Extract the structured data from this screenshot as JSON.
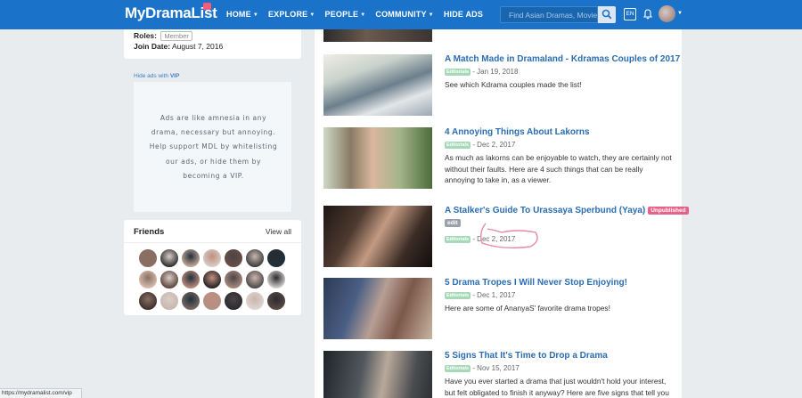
{
  "navbar": {
    "logo": "MyDramaList",
    "links": [
      {
        "label": "HOME",
        "dropdown": true
      },
      {
        "label": "EXPLORE",
        "dropdown": true
      },
      {
        "label": "PEOPLE",
        "dropdown": true
      },
      {
        "label": "COMMUNITY",
        "dropdown": true
      },
      {
        "label": "HIDE ADS",
        "dropdown": false
      }
    ],
    "search_placeholder": "Find Asian Dramas, Movies",
    "lang": "EN",
    "icons": [
      "search-icon",
      "bell-icon",
      "avatar"
    ]
  },
  "profile": {
    "roles_label": "Roles:",
    "role_badge": "Member",
    "join_label": "Join Date:",
    "join_value": "August 7, 2016"
  },
  "ads": {
    "hide_prefix": "Hide ads with",
    "hide_vip": "VIP",
    "lines": [
      "Ads are like amnesia in any",
      "drama, necessary but annoying.",
      "Help support MDL by whitelisting",
      "our ads, or hide them by",
      "becoming a VIP."
    ]
  },
  "friends": {
    "title": "Friends",
    "view_all": "View all",
    "count": 21
  },
  "articles": [
    {
      "title": "A Match Made in Dramaland - Kdramas Couples of 2017",
      "tag": "Editorials",
      "date": "- Jan 19, 2018",
      "desc": "See which Kdrama couples made the list!"
    },
    {
      "title": "4 Annoying Things About Lakorns",
      "tag": "Editorials",
      "date": "- Dec 2, 2017",
      "desc": "As much as lakorns can be enjoyable to watch, they are certainly not without their faults. Here are 4 such things that can be really annoying to take in, as a viewer."
    },
    {
      "title": "A Stalker's Guide To Urassaya Sperbund (Yaya)",
      "unpublished": "Unpublished",
      "edit": "edit",
      "tag": "Editorials",
      "date": "- Dec 2, 2017",
      "desc": ""
    },
    {
      "title": "5 Drama Tropes I Will Never Stop Enjoying!",
      "tag": "Editorials",
      "date": "- Dec 1, 2017",
      "desc": "Here are some of AnanyaS' favorite drama tropes!"
    },
    {
      "title": "5 Signs That It's Time to Drop a Drama",
      "tag": "Editorials",
      "date": "- Nov 15, 2017",
      "desc": "Have you ever started a drama that just wouldn't hold your interest, but felt obligated to finish it anyway? Here are five signs that tell you"
    }
  ],
  "status_url": "https://mydramalist.com/vip",
  "colors": {
    "navbar": "#1a73c8",
    "link": "#2a6db3",
    "editorials_badge": "#a6d9b7",
    "unpublished_badge": "#e6628a",
    "annotation": "#e88a9e"
  }
}
